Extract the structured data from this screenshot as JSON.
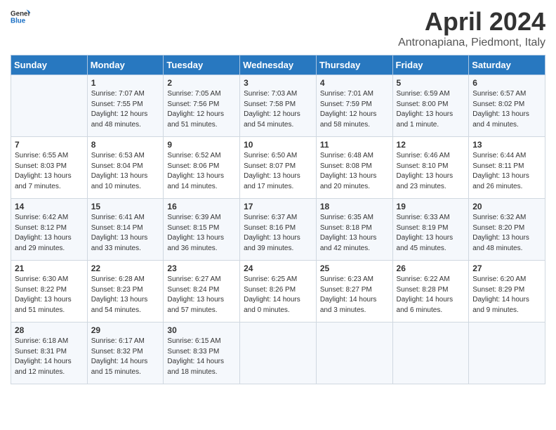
{
  "header": {
    "logo_general": "General",
    "logo_blue": "Blue",
    "title": "April 2024",
    "subtitle": "Antronapiana, Piedmont, Italy"
  },
  "columns": [
    "Sunday",
    "Monday",
    "Tuesday",
    "Wednesday",
    "Thursday",
    "Friday",
    "Saturday"
  ],
  "rows": [
    [
      {
        "day": "",
        "sunrise": "",
        "sunset": "",
        "daylight": ""
      },
      {
        "day": "1",
        "sunrise": "Sunrise: 7:07 AM",
        "sunset": "Sunset: 7:55 PM",
        "daylight": "Daylight: 12 hours and 48 minutes."
      },
      {
        "day": "2",
        "sunrise": "Sunrise: 7:05 AM",
        "sunset": "Sunset: 7:56 PM",
        "daylight": "Daylight: 12 hours and 51 minutes."
      },
      {
        "day": "3",
        "sunrise": "Sunrise: 7:03 AM",
        "sunset": "Sunset: 7:58 PM",
        "daylight": "Daylight: 12 hours and 54 minutes."
      },
      {
        "day": "4",
        "sunrise": "Sunrise: 7:01 AM",
        "sunset": "Sunset: 7:59 PM",
        "daylight": "Daylight: 12 hours and 58 minutes."
      },
      {
        "day": "5",
        "sunrise": "Sunrise: 6:59 AM",
        "sunset": "Sunset: 8:00 PM",
        "daylight": "Daylight: 13 hours and 1 minute."
      },
      {
        "day": "6",
        "sunrise": "Sunrise: 6:57 AM",
        "sunset": "Sunset: 8:02 PM",
        "daylight": "Daylight: 13 hours and 4 minutes."
      }
    ],
    [
      {
        "day": "7",
        "sunrise": "Sunrise: 6:55 AM",
        "sunset": "Sunset: 8:03 PM",
        "daylight": "Daylight: 13 hours and 7 minutes."
      },
      {
        "day": "8",
        "sunrise": "Sunrise: 6:53 AM",
        "sunset": "Sunset: 8:04 PM",
        "daylight": "Daylight: 13 hours and 10 minutes."
      },
      {
        "day": "9",
        "sunrise": "Sunrise: 6:52 AM",
        "sunset": "Sunset: 8:06 PM",
        "daylight": "Daylight: 13 hours and 14 minutes."
      },
      {
        "day": "10",
        "sunrise": "Sunrise: 6:50 AM",
        "sunset": "Sunset: 8:07 PM",
        "daylight": "Daylight: 13 hours and 17 minutes."
      },
      {
        "day": "11",
        "sunrise": "Sunrise: 6:48 AM",
        "sunset": "Sunset: 8:08 PM",
        "daylight": "Daylight: 13 hours and 20 minutes."
      },
      {
        "day": "12",
        "sunrise": "Sunrise: 6:46 AM",
        "sunset": "Sunset: 8:10 PM",
        "daylight": "Daylight: 13 hours and 23 minutes."
      },
      {
        "day": "13",
        "sunrise": "Sunrise: 6:44 AM",
        "sunset": "Sunset: 8:11 PM",
        "daylight": "Daylight: 13 hours and 26 minutes."
      }
    ],
    [
      {
        "day": "14",
        "sunrise": "Sunrise: 6:42 AM",
        "sunset": "Sunset: 8:12 PM",
        "daylight": "Daylight: 13 hours and 29 minutes."
      },
      {
        "day": "15",
        "sunrise": "Sunrise: 6:41 AM",
        "sunset": "Sunset: 8:14 PM",
        "daylight": "Daylight: 13 hours and 33 minutes."
      },
      {
        "day": "16",
        "sunrise": "Sunrise: 6:39 AM",
        "sunset": "Sunset: 8:15 PM",
        "daylight": "Daylight: 13 hours and 36 minutes."
      },
      {
        "day": "17",
        "sunrise": "Sunrise: 6:37 AM",
        "sunset": "Sunset: 8:16 PM",
        "daylight": "Daylight: 13 hours and 39 minutes."
      },
      {
        "day": "18",
        "sunrise": "Sunrise: 6:35 AM",
        "sunset": "Sunset: 8:18 PM",
        "daylight": "Daylight: 13 hours and 42 minutes."
      },
      {
        "day": "19",
        "sunrise": "Sunrise: 6:33 AM",
        "sunset": "Sunset: 8:19 PM",
        "daylight": "Daylight: 13 hours and 45 minutes."
      },
      {
        "day": "20",
        "sunrise": "Sunrise: 6:32 AM",
        "sunset": "Sunset: 8:20 PM",
        "daylight": "Daylight: 13 hours and 48 minutes."
      }
    ],
    [
      {
        "day": "21",
        "sunrise": "Sunrise: 6:30 AM",
        "sunset": "Sunset: 8:22 PM",
        "daylight": "Daylight: 13 hours and 51 minutes."
      },
      {
        "day": "22",
        "sunrise": "Sunrise: 6:28 AM",
        "sunset": "Sunset: 8:23 PM",
        "daylight": "Daylight: 13 hours and 54 minutes."
      },
      {
        "day": "23",
        "sunrise": "Sunrise: 6:27 AM",
        "sunset": "Sunset: 8:24 PM",
        "daylight": "Daylight: 13 hours and 57 minutes."
      },
      {
        "day": "24",
        "sunrise": "Sunrise: 6:25 AM",
        "sunset": "Sunset: 8:26 PM",
        "daylight": "Daylight: 14 hours and 0 minutes."
      },
      {
        "day": "25",
        "sunrise": "Sunrise: 6:23 AM",
        "sunset": "Sunset: 8:27 PM",
        "daylight": "Daylight: 14 hours and 3 minutes."
      },
      {
        "day": "26",
        "sunrise": "Sunrise: 6:22 AM",
        "sunset": "Sunset: 8:28 PM",
        "daylight": "Daylight: 14 hours and 6 minutes."
      },
      {
        "day": "27",
        "sunrise": "Sunrise: 6:20 AM",
        "sunset": "Sunset: 8:29 PM",
        "daylight": "Daylight: 14 hours and 9 minutes."
      }
    ],
    [
      {
        "day": "28",
        "sunrise": "Sunrise: 6:18 AM",
        "sunset": "Sunset: 8:31 PM",
        "daylight": "Daylight: 14 hours and 12 minutes."
      },
      {
        "day": "29",
        "sunrise": "Sunrise: 6:17 AM",
        "sunset": "Sunset: 8:32 PM",
        "daylight": "Daylight: 14 hours and 15 minutes."
      },
      {
        "day": "30",
        "sunrise": "Sunrise: 6:15 AM",
        "sunset": "Sunset: 8:33 PM",
        "daylight": "Daylight: 14 hours and 18 minutes."
      },
      {
        "day": "",
        "sunrise": "",
        "sunset": "",
        "daylight": ""
      },
      {
        "day": "",
        "sunrise": "",
        "sunset": "",
        "daylight": ""
      },
      {
        "day": "",
        "sunrise": "",
        "sunset": "",
        "daylight": ""
      },
      {
        "day": "",
        "sunrise": "",
        "sunset": "",
        "daylight": ""
      }
    ]
  ]
}
